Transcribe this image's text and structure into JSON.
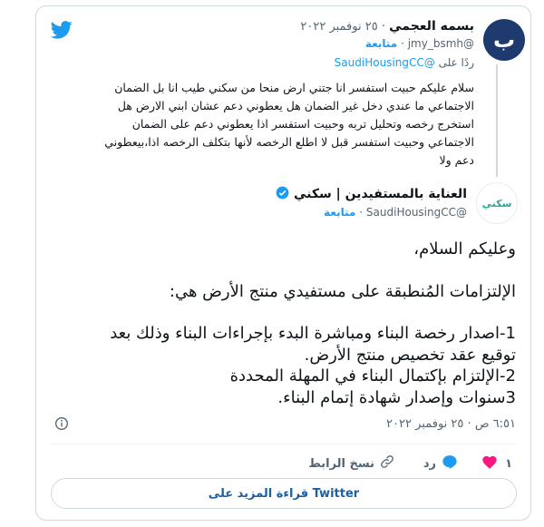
{
  "colors": {
    "twitter_blue": "#1d9bf0",
    "avatar_bg": "#1e3a6e",
    "heart": "#f91880",
    "verified": "#1d9bf0"
  },
  "reply_tweet": {
    "avatar_letter": "ب",
    "name": "بسمه العجمي",
    "date": "٢٥ نوفمبر ٢٠٢٢",
    "dot": "·",
    "handle": "@jmy_bsmh",
    "follow": "متابعة",
    "replying_to_prefix": "ردًا على",
    "replying_to_handle": "@SaudiHousingCC",
    "text": "سلام عليكم حبيت استفسر انا جتني ارض منحا من سكني طيب انا بل الضمان الاجتماعي ما عندي دخل غير الضمان هل يعطوني دعم عشان ابني الارض هل استخرج رخصه وتحليل تربه وحبيت استفسر اذا يعطوني دعم على الضمان الاجتماعي وحبيت استفسر قبل لا اطلع الرخصه لأنها بتكلف الرخصه اذا،بيعطوني دعم ولا"
  },
  "main_tweet": {
    "avatar_text": "سكني",
    "name": "العناية بالمستفيدين | سكني",
    "handle": "@SaudiHousingCC",
    "follow": "متابعة",
    "lines": [
      "وعليكم السلام،",
      "الإلتزامات المُنطبقة على مستفيدي منتج الأرض هي:",
      "1-اصدار رخصة البناء ومباشرة البدء بإجراءات البناء وذلك بعد",
      "توقيع عقد تخصيص منتج الأرض.",
      "2-الإلتزام بإكتمال البناء في المهلة المحددة",
      "3سنوات وإصدار شهادة إتمام البناء."
    ],
    "time": "٦:٥١ ص",
    "date": "٢٥ نوفمبر ٢٠٢٢",
    "dot": "·"
  },
  "actions": {
    "like_count": "١",
    "reply_label": "رد",
    "copy_link_label": "نسخ الرابط"
  },
  "read_more": "قراءة المزيد على Twitter",
  "icons": [
    "twitter-logo-icon",
    "verified-icon",
    "info-icon",
    "heart-icon",
    "reply-icon",
    "link-icon"
  ]
}
